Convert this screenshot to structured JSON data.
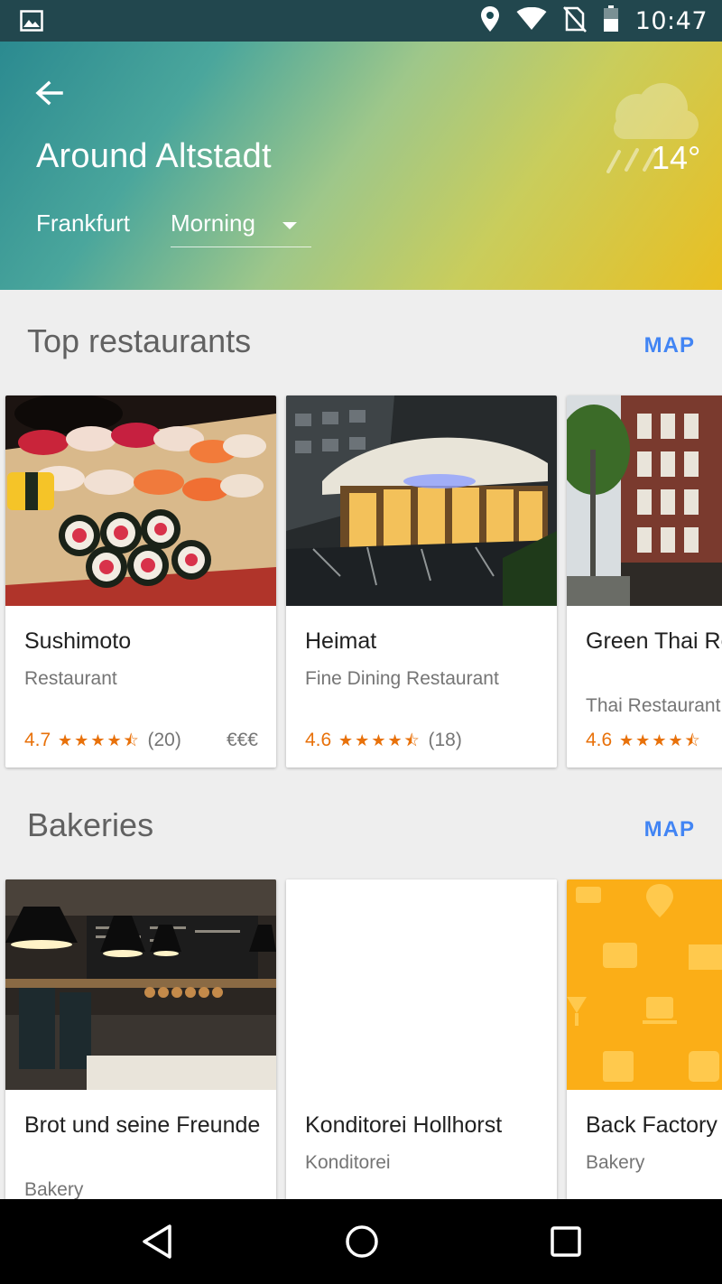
{
  "status_bar": {
    "time": "10:47",
    "icons": [
      "image-icon",
      "location-icon",
      "wifi-icon",
      "no-sim-icon",
      "battery-icon"
    ]
  },
  "header": {
    "title": "Around Altstadt",
    "city": "Frankfurt",
    "time_of_day": "Morning",
    "temperature": "14°",
    "weather_icon": "rain-cloud-icon",
    "back_icon": "arrow-back-icon"
  },
  "sections": {
    "restaurants": {
      "title": "Top restaurants",
      "map_label": "MAP",
      "cards": [
        {
          "name": "Sushimoto",
          "type": "Restaurant",
          "rating": "4.7",
          "stars": "★★★★⯪",
          "count": "(20)",
          "price": "€€€"
        },
        {
          "name": "Heimat",
          "type": "Fine Dining Restaurant",
          "rating": "4.6",
          "stars": "★★★★⯪",
          "count": "(18)"
        },
        {
          "name": "Green Thai Restaurant",
          "type": "Thai Restaurant",
          "rating": "4.6",
          "stars": "★★★★⯪"
        }
      ]
    },
    "bakeries": {
      "title": "Bakeries",
      "map_label": "MAP",
      "cards": [
        {
          "name": "Brot und seine Freunde",
          "type": "Bakery"
        },
        {
          "name": "Konditorei Hollhorst",
          "type": "Konditorei"
        },
        {
          "name": "Back Factory",
          "type": "Bakery"
        }
      ]
    }
  },
  "colors": {
    "accent": "#4285f4",
    "rating": "#e8710a",
    "placeholder_orange": "#fbae17"
  }
}
